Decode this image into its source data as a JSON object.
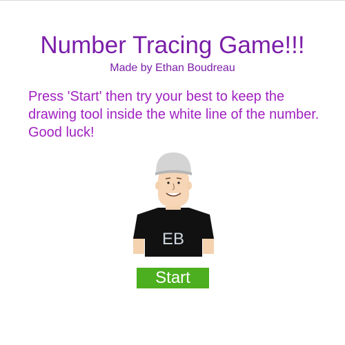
{
  "header": {
    "title": "Number Tracing Game!!!",
    "subtitle": "Made by Ethan Boudreau"
  },
  "instructions": "Press 'Start' then try your best to keep the drawing tool inside the white line of the number. Good luck!",
  "avatar": {
    "shirt_text": "EB",
    "icon": "cartoon-person-with-cap"
  },
  "controls": {
    "start_label": "Start"
  },
  "colors": {
    "title": "#7a1ea8",
    "instructions": "#a020c0",
    "start_button": "#4caf1f",
    "shirt": "#111111",
    "cap": "#d4d4d4",
    "skin": "#f4d2b0"
  }
}
